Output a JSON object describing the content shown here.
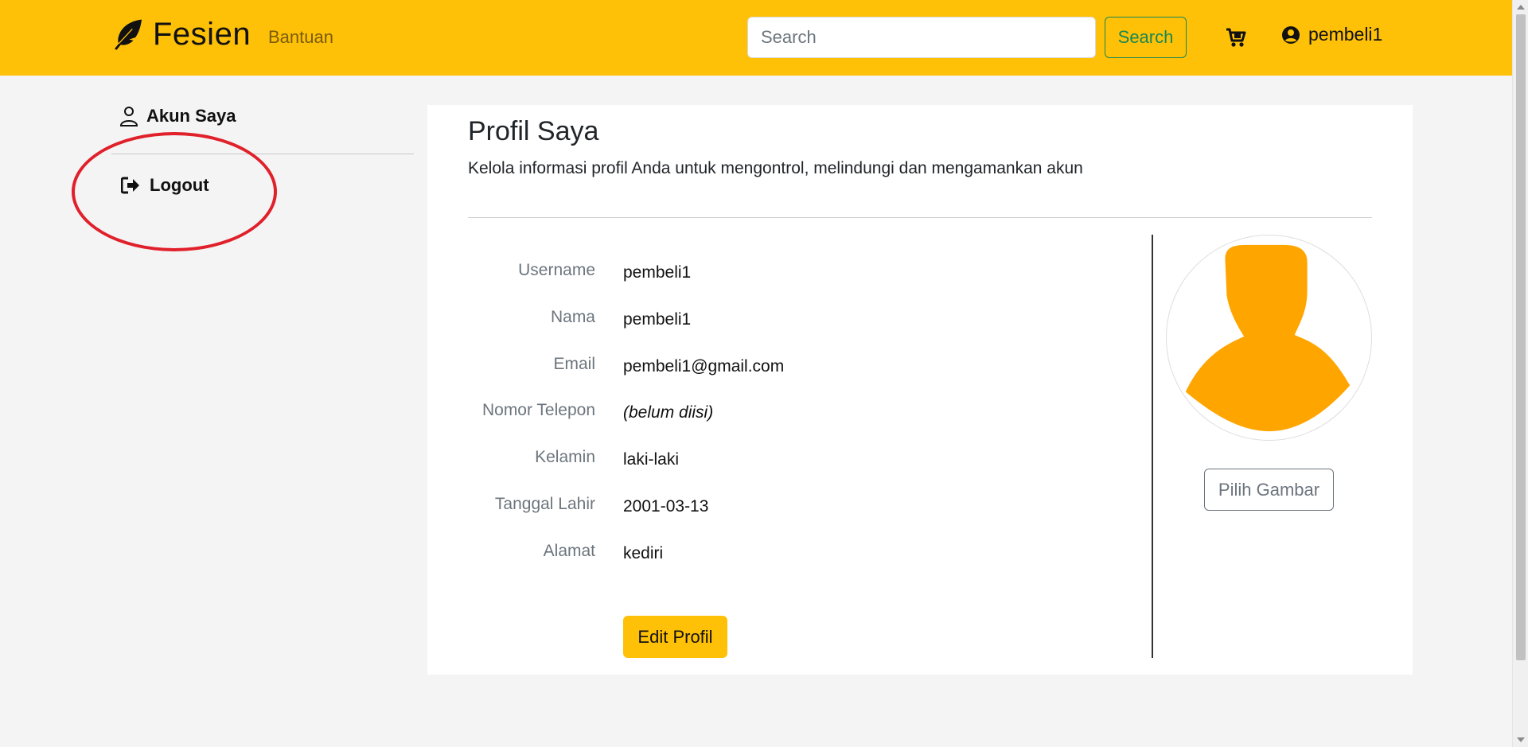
{
  "navbar": {
    "brand": "Fesien",
    "help_link": "Bantuan",
    "search_placeholder": "Search",
    "search_button": "Search",
    "cart_icon": "cart-icon",
    "username": "pembeli1"
  },
  "sidebar": {
    "account_label": "Akun Saya",
    "logout_label": "Logout"
  },
  "profile": {
    "title": "Profil Saya",
    "subtitle": "Kelola informasi profil Anda untuk mengontrol, melindungi dan mengamankan akun",
    "fields": [
      {
        "label": "Username",
        "value": "pembeli1"
      },
      {
        "label": "Nama",
        "value": "pembeli1"
      },
      {
        "label": "Email",
        "value": "pembeli1@gmail.com"
      },
      {
        "label": "Nomor Telepon",
        "value": "(belum diisi)"
      },
      {
        "label": "Kelamin",
        "value": "laki-laki"
      },
      {
        "label": "Tanggal Lahir",
        "value": "2001-03-13"
      },
      {
        "label": "Alamat",
        "value": "kediri"
      }
    ],
    "edit_button": "Edit Profil",
    "choose_image_button": "Pilih Gambar"
  },
  "colors": {
    "navbar": "#ffc107",
    "avatar": "#ffa500",
    "annotation": "#e0202a",
    "search_button": "#198754"
  }
}
